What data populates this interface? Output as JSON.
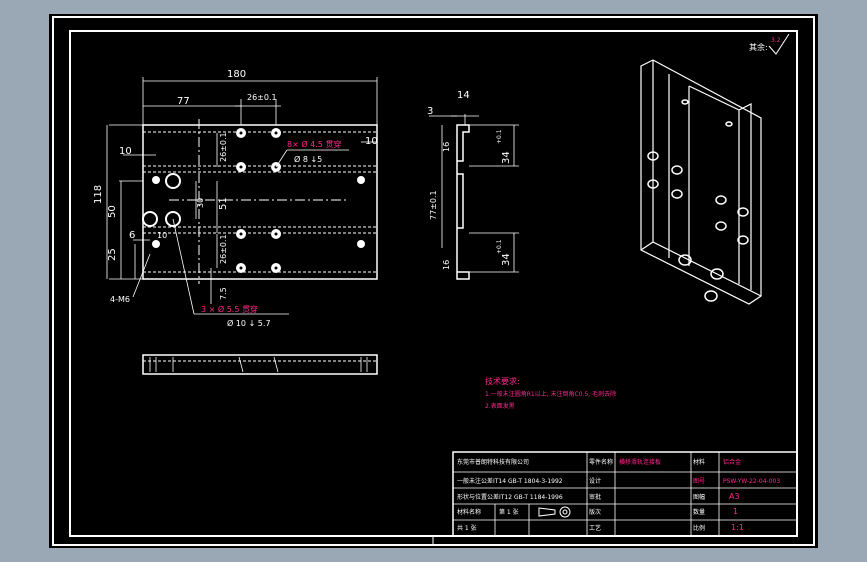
{
  "drawing": {
    "roughness": {
      "label": "其余:",
      "value": "3.2"
    },
    "dims": {
      "top": {
        "overall_width": "180",
        "w77": "77",
        "w26": "26±0.1",
        "overall_height": "118",
        "h50": "50",
        "h25": "25",
        "h10": "10",
        "h6": "6",
        "r10": "10",
        "v26a": "26±0.1",
        "v26b": "26±0.1",
        "v51": "51",
        "v30": "30",
        "v7_5": "7.5",
        "holes_4m6": "4-M6",
        "note8": "8× Ø 4.5 贯穿",
        "note8b": "Ø 8 ↓5",
        "note3": "3 × Ø 5.5 贯穿",
        "note3b": "Ø 10 ↓ 5.7"
      },
      "side": {
        "t3": "3",
        "t14": "14",
        "t16a": "16",
        "t16b": "16",
        "v34a": "34",
        "v34b": "34",
        "v77": "77±0.1",
        "tol_plus": "+0.1",
        "tol_zero": "0"
      }
    },
    "tech_requirements": {
      "title": "技术要求:",
      "line1": "1.一般未注圆角R1以上, 未注倒角C0.5, 毛刺去除",
      "line2": "2.表面发黑"
    },
    "title_block": {
      "company": "东莞市普朗特科技有限公司",
      "tol1": "一般未注公差IT14 GB-T 1804-3-1992",
      "tol2": "形状与位置公差IT12 GB-T 1184-1996",
      "material_label": "设计",
      "item1": "材料名称",
      "item2": "审批",
      "item3": "版次",
      "item4": "数量",
      "item5": "工艺",
      "product_label": "零件名称",
      "product_name": "横移滑轨连接板",
      "label_material": "材料",
      "material": "铝合金",
      "label_drawno": "图号",
      "drawing_no": "PSW-YW-22-04-003",
      "label_size": "图幅",
      "size": "A3",
      "label_qty": "数量",
      "qty": "1",
      "label_scale": "比例",
      "scale": "1:1",
      "sheet": "第 1 张",
      "page": "共 1 张"
    }
  }
}
